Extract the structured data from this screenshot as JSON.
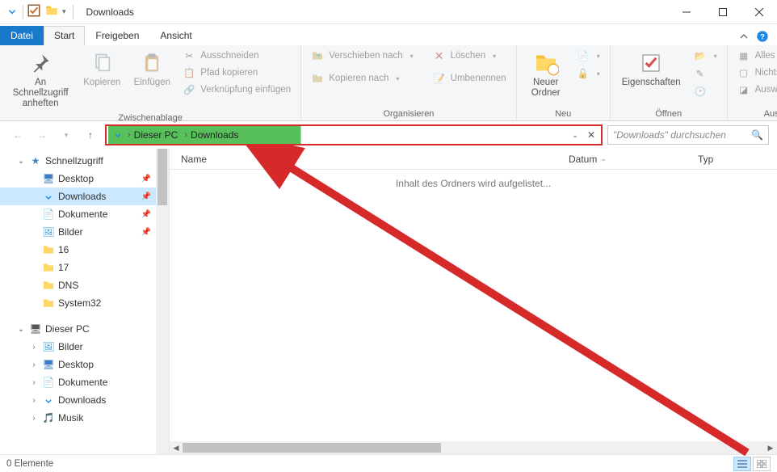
{
  "window": {
    "title": "Downloads"
  },
  "tabs": {
    "file": "Datei",
    "start": "Start",
    "share": "Freigeben",
    "view": "Ansicht"
  },
  "ribbon": {
    "clipboard": {
      "label": "Zwischenablage",
      "pin": "An Schnellzugriff\nanheften",
      "copy": "Kopieren",
      "paste": "Einfügen",
      "cut": "Ausschneiden",
      "copy_path": "Pfad kopieren",
      "paste_shortcut": "Verknüpfung einfügen"
    },
    "organize": {
      "label": "Organisieren",
      "move_to": "Verschieben nach",
      "copy_to": "Kopieren nach",
      "delete": "Löschen",
      "rename": "Umbenennen"
    },
    "new": {
      "label": "Neu",
      "new_folder": "Neuer\nOrdner"
    },
    "open": {
      "label": "Öffnen",
      "properties": "Eigenschaften"
    },
    "select": {
      "label": "Auswählen",
      "select_all": "Alles auswählen",
      "select_none": "Nichts auswählen",
      "invert": "Auswahl umkehren"
    }
  },
  "breadcrumb": {
    "pc": "Dieser PC",
    "dl": "Downloads"
  },
  "search": {
    "placeholder": "\"Downloads\" durchsuchen"
  },
  "columns": {
    "name": "Name",
    "date": "Datum",
    "type": "Typ"
  },
  "content": {
    "loading": "Inhalt des Ordners wird aufgelistet..."
  },
  "tree": {
    "quick": "Schnellzugriff",
    "desktop": "Desktop",
    "downloads": "Downloads",
    "documents": "Dokumente",
    "pictures": "Bilder",
    "f16": "16",
    "f17": "17",
    "dns": "DNS",
    "sys32": "System32",
    "thispc": "Dieser PC",
    "tp_pictures": "Bilder",
    "tp_desktop": "Desktop",
    "tp_documents": "Dokumente",
    "tp_downloads": "Downloads",
    "tp_music": "Musik"
  },
  "status": {
    "items": "0 Elemente"
  }
}
